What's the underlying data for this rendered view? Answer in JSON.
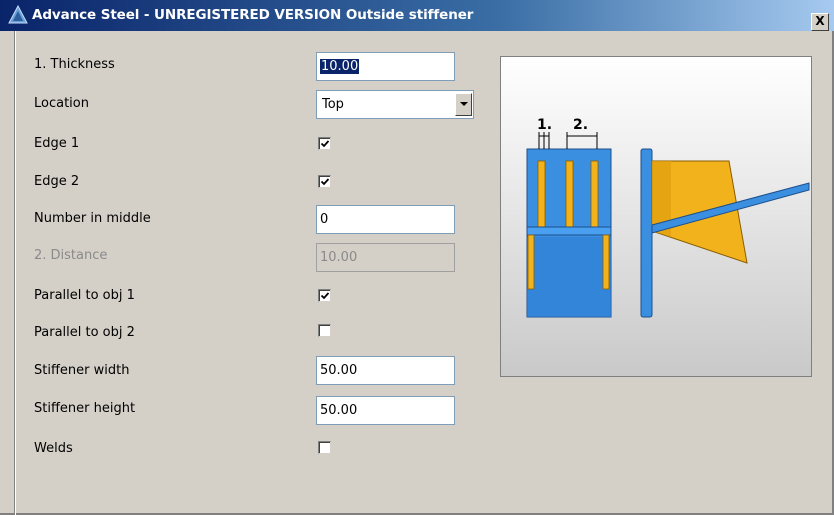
{
  "window": {
    "title": "Advance Steel - UNREGISTERED VERSION  Outside stiffener",
    "close_label": "X"
  },
  "fields": {
    "thickness": {
      "label": "1. Thickness",
      "value": "10.00"
    },
    "location": {
      "label": "Location",
      "value": "Top"
    },
    "edge1": {
      "label": "Edge 1",
      "checked": true
    },
    "edge2": {
      "label": "Edge 2",
      "checked": true
    },
    "number_in_middle": {
      "label": "Number in middle",
      "value": "0"
    },
    "distance": {
      "label": "2. Distance",
      "value": "10.00",
      "disabled": true
    },
    "parallel_obj1": {
      "label": "Parallel to obj 1",
      "checked": true
    },
    "parallel_obj2": {
      "label": "Parallel to obj 2",
      "checked": false
    },
    "stiffener_width": {
      "label": "Stiffener width",
      "value": "50.00"
    },
    "stiffener_height": {
      "label": "Stiffener height",
      "value": "50.00"
    },
    "welds": {
      "label": "Welds",
      "checked": false
    }
  },
  "preview": {
    "dim_label_1": "1.",
    "dim_label_2": "2."
  },
  "colors": {
    "steel_blue": "#3b8fe0",
    "stiffener_yellow": "#f2b21c",
    "titlebar": "#0a246a"
  }
}
